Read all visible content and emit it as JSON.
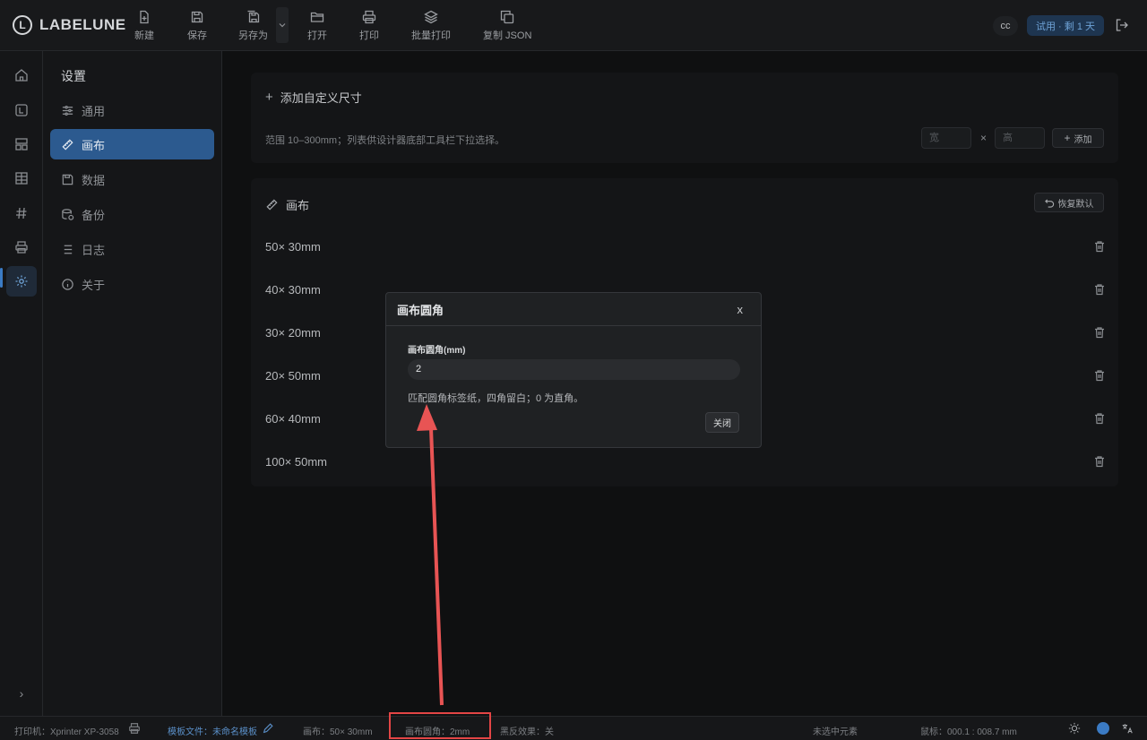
{
  "app": {
    "brand": "LABELUNE",
    "logo_letter": "L"
  },
  "toolbar": {
    "items": [
      {
        "label": "新建",
        "icon": "file-plus-icon"
      },
      {
        "label": "保存",
        "icon": "save-icon"
      },
      {
        "label": "另存为",
        "icon": "save-as-icon"
      },
      {
        "label": "打开",
        "icon": "folder-open-icon"
      },
      {
        "label": "打印",
        "icon": "printer-icon"
      },
      {
        "label": "批量打印",
        "icon": "layers-icon"
      },
      {
        "label": "复制 JSON",
        "icon": "copy-icon"
      }
    ],
    "user_initials": "cc",
    "trial_badge": "试用 · 剩 1 天"
  },
  "rail": [
    "home-icon",
    "label-icon",
    "layout-icon",
    "table-icon",
    "hash-icon",
    "printer-icon",
    "settings-icon"
  ],
  "sidebar": {
    "title": "设置",
    "items": [
      {
        "label": "通用",
        "icon": "sliders-icon"
      },
      {
        "label": "画布",
        "icon": "ruler-icon",
        "active": true
      },
      {
        "label": "数据",
        "icon": "database-icon"
      },
      {
        "label": "备份",
        "icon": "backup-icon"
      },
      {
        "label": "日志",
        "icon": "list-icon"
      },
      {
        "label": "关于",
        "icon": "info-icon"
      }
    ]
  },
  "custom_size": {
    "title": "添加自定义尺寸",
    "hint": "范围 10–300mm；列表供设计器底部工具栏下拉选择。",
    "width_placeholder": "宽",
    "height_placeholder": "高",
    "times": "×",
    "add_label": "添加"
  },
  "canvas_list": {
    "title": "画布",
    "reset_label": "恢复默认",
    "sizes": [
      "50× 30mm",
      "40× 30mm",
      "30× 20mm",
      "20× 50mm",
      "60× 40mm",
      "100× 50mm"
    ]
  },
  "modal": {
    "title": "画布圆角",
    "close_x": "x",
    "field_label": "画布圆角(mm)",
    "value": "2",
    "help": "匹配圆角标签纸，四角留白；0 为直角。",
    "close_button": "关闭"
  },
  "status": {
    "printer": "打印机：Xprinter XP-3058",
    "template_label": "模板文件：",
    "template_name": "未命名模板",
    "canvas": "画布：50× 30mm",
    "corner": "画布圆角：2mm",
    "invert": "黑反效果：关",
    "selection": "未选中元素",
    "mouse": "鼠标：000.1 : 008.7 mm"
  },
  "colors": {
    "accent": "#2c5a8f",
    "annotation": "#e34545"
  }
}
